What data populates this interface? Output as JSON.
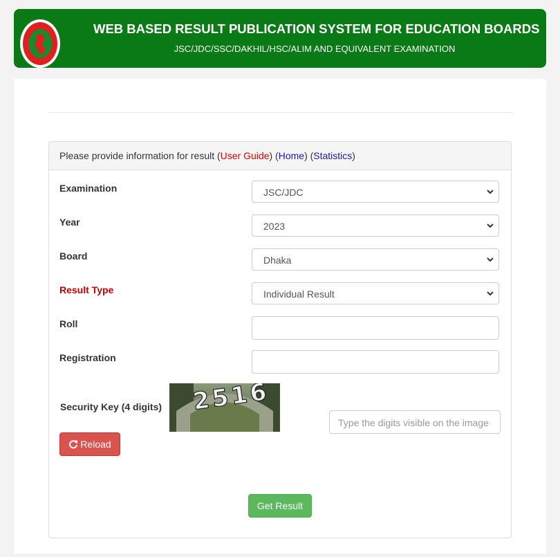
{
  "header": {
    "title": "WEB BASED RESULT PUBLICATION SYSTEM FOR EDUCATION BOARDS",
    "subtitle": "JSC/JDC/SSC/DAKHIL/HSC/ALIM AND EQUIVALENT EXAMINATION",
    "logo_icon": "bangladesh-govt-seal-icon"
  },
  "panel": {
    "intro": "Please provide information for result",
    "user_guide": "User Guide",
    "home": "Home",
    "statistics": "Statistics"
  },
  "form": {
    "examination": {
      "label": "Examination",
      "value": "JSC/JDC"
    },
    "year": {
      "label": "Year",
      "value": "2023"
    },
    "board": {
      "label": "Board",
      "value": "Dhaka"
    },
    "result_type": {
      "label": "Result Type",
      "value": "Individual Result"
    },
    "roll": {
      "label": "Roll",
      "value": ""
    },
    "registration": {
      "label": "Registration",
      "value": ""
    },
    "security": {
      "label": "Security Key (4 digits)",
      "captcha": "2516",
      "placeholder": "Type the digits visible on the image"
    },
    "reload_label": "Reload",
    "reload_icon": "refresh-icon",
    "submit_label": "Get Result"
  },
  "colors": {
    "header_bg": "#0a7a16",
    "reload_bg": "#d9534f",
    "submit_bg": "#5cb85c",
    "required_label": "#c00000"
  }
}
